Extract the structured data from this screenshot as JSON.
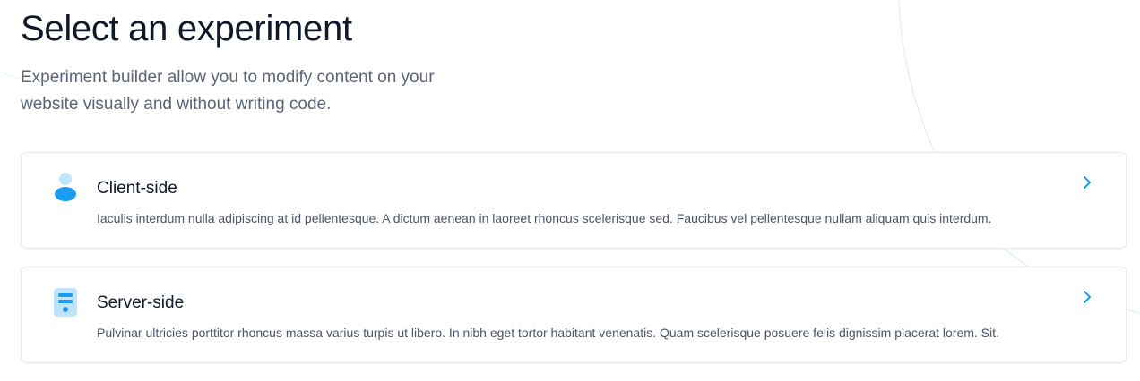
{
  "header": {
    "title": "Select an experiment",
    "subtitle": "Experiment builder allow you to modify content on your website visually and without writing code."
  },
  "options": [
    {
      "title": "Client-side",
      "description": "Iaculis interdum nulla adipiscing at id pellentesque. A dictum aenean in laoreet rhoncus scelerisque sed. Faucibus vel pellentesque nullam aliquam quis interdum.",
      "icon": "user-icon"
    },
    {
      "title": "Server-side",
      "description": "Pulvinar ultricies porttitor rhoncus massa varius turpis ut libero. In nibh eget tortor habitant venenatis. Quam scelerisque posuere felis dignissim placerat lorem. Sit.",
      "icon": "server-icon"
    }
  ],
  "colors": {
    "accent": "#1a9df0",
    "accent_light": "#bfe4fb",
    "text_primary": "#0f1729",
    "text_secondary": "#5b6478",
    "border": "#e6e9ee"
  }
}
